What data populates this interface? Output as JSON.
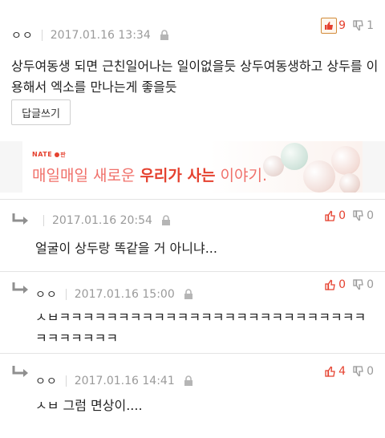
{
  "main_comment": {
    "author": "ㅇㅇ",
    "datetime": "2017.01.16 13:34",
    "upvotes": "9",
    "downvotes": "1",
    "text": "상두여동생 되면 근친일어나는 일이없을듯 상두여동생하고 상두를 이용해서 엑소를 만나는게 좋을듯",
    "reply_button": "답글쓰기"
  },
  "banner": {
    "brand": "NATE",
    "brand_tag": "판",
    "text_plain": "매일매일 새로운 ",
    "text_highlight": "우리가 사는",
    "text_end": " 이야기."
  },
  "replies": [
    {
      "author": "",
      "datetime": "2017.01.16 20:54",
      "upvotes": "0",
      "downvotes": "0",
      "text": "얼굴이 상두랑 똑같을 거 아니냐..."
    },
    {
      "author": "ㅇㅇ",
      "datetime": "2017.01.16 15:00",
      "upvotes": "0",
      "downvotes": "0",
      "text": "ㅅㅂㅋㅋㅋㅋㅋㅋㅋㅋㅋㅋㅋㅋㅋㅋㅋㅋㅋㅋㅋㅋㅋㅋㅋㅋㅋㅋㅋㅋㅋㅋㅋㅋㅋ"
    },
    {
      "author": "ㅇㅇ",
      "datetime": "2017.01.16 14:41",
      "upvotes": "4",
      "downvotes": "0",
      "text": "ㅅㅂ 그럼 면상이...."
    }
  ],
  "colors": {
    "upvote": "#e5412f",
    "muted": "#9a9a9a",
    "accent_box": "#d28b3a"
  },
  "icons": {
    "lock": "lock-icon",
    "thumbs_up": "thumbs-up-icon",
    "thumbs_down": "thumbs-down-icon",
    "reply_arrow": "reply-arrow-icon"
  }
}
